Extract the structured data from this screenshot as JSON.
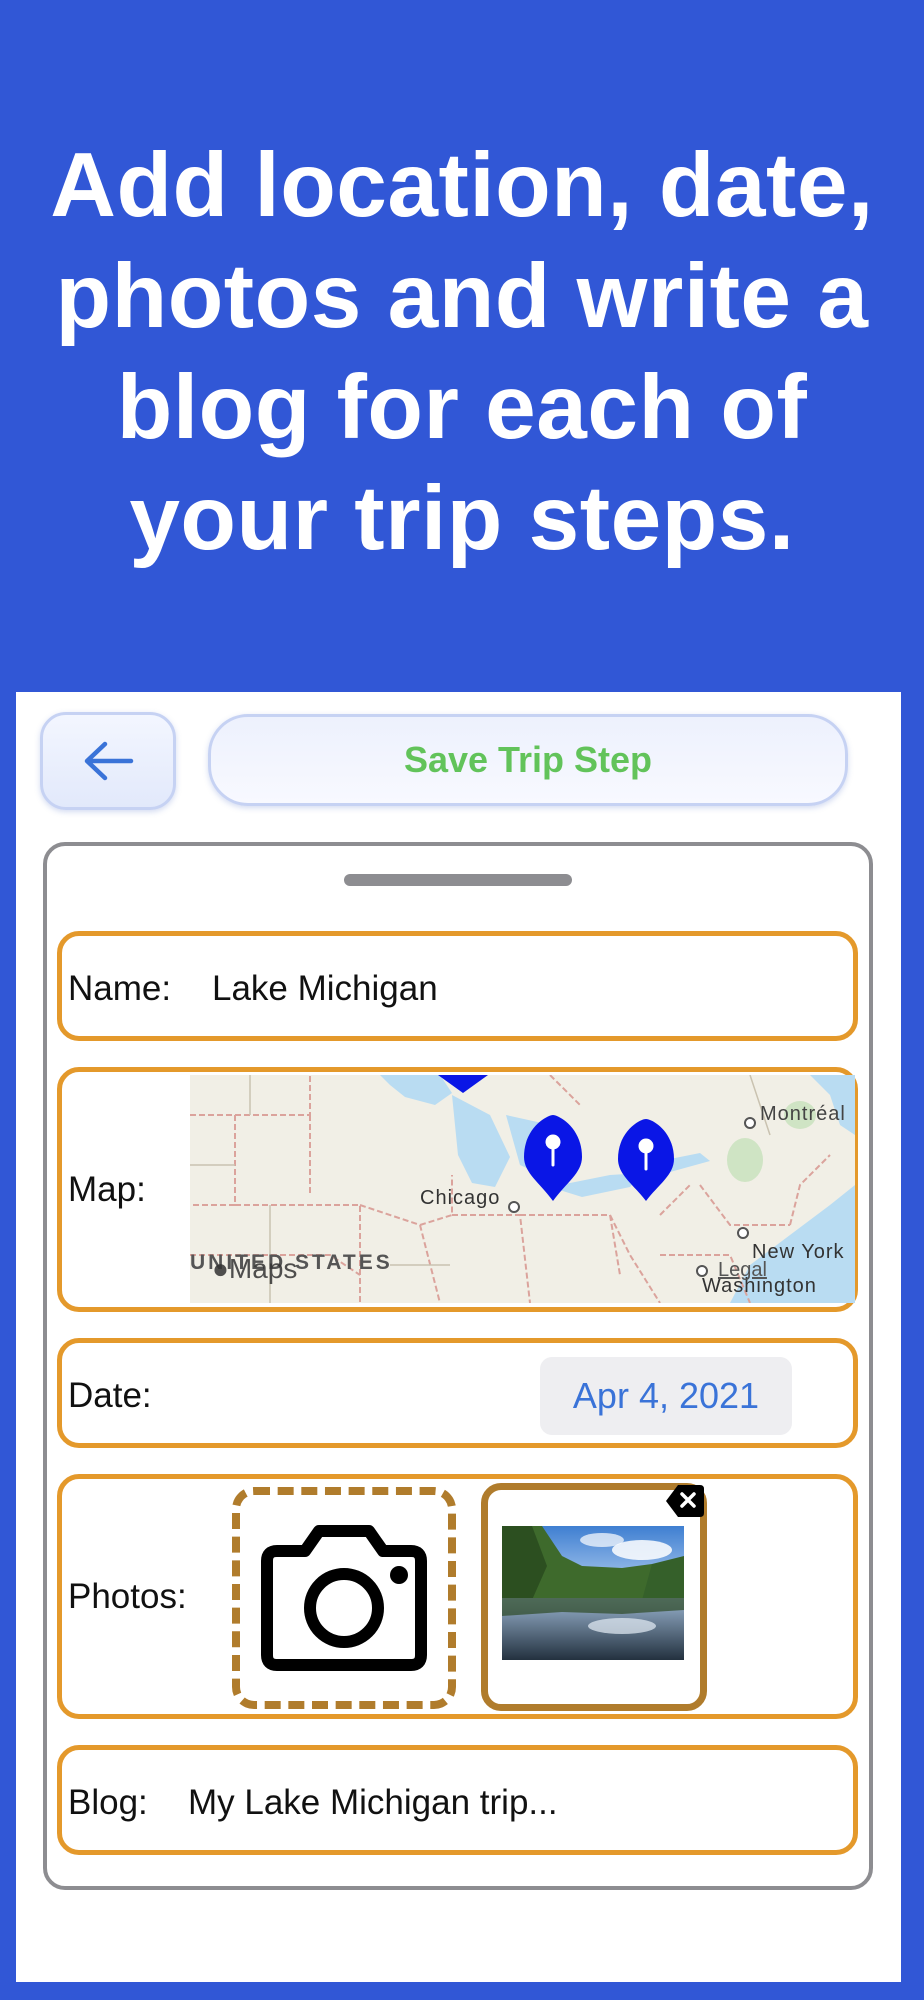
{
  "headline": {
    "line1": "Add location, date,",
    "line2": "photos and write a",
    "line3": "blog for each of",
    "line4": "your trip steps."
  },
  "toolbar": {
    "back_icon": "arrow-left-icon",
    "save_label": "Save Trip Step"
  },
  "form": {
    "name": {
      "label": "Name:",
      "value": "Lake Michigan"
    },
    "map": {
      "label": "Map:",
      "cities": [
        "Montréal",
        "Chicago",
        "New York",
        "Washington"
      ],
      "country": "UNITED STATES",
      "attribution": "Maps",
      "legal": "Legal",
      "pin_color": "#0a16e6"
    },
    "date": {
      "label": "Date:",
      "value": "Apr 4, 2021"
    },
    "photos": {
      "label": "Photos:",
      "add_icon": "camera-icon",
      "delete_icon": "delete-icon"
    },
    "blog": {
      "label": "Blog:",
      "value": "My Lake Michigan trip..."
    }
  },
  "colors": {
    "background": "#3157d6",
    "row_border": "#e4992b",
    "save_text": "#62c35a",
    "date_text": "#3a73d8"
  }
}
